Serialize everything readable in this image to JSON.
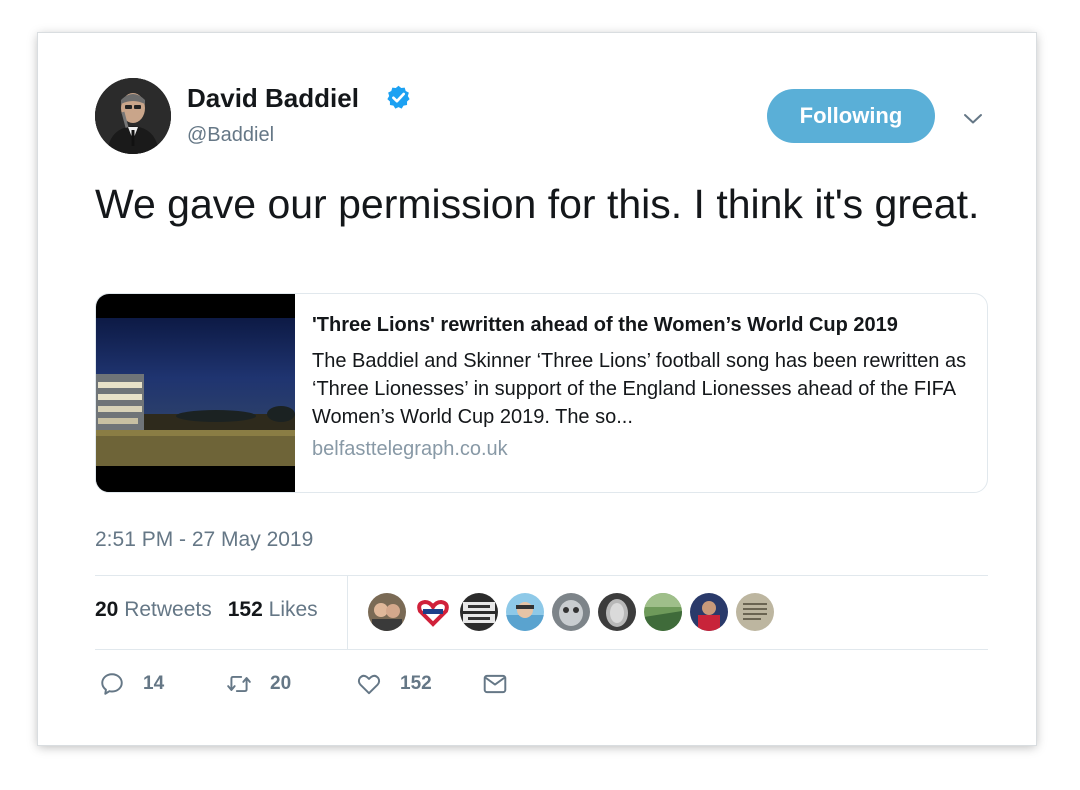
{
  "author": {
    "name": "David Baddiel",
    "handle": "@Baddiel",
    "verified": true
  },
  "follow_button": {
    "label": "Following",
    "color": "#5aafd7"
  },
  "tweet": {
    "text": "We gave our permission for this. I think it's great."
  },
  "link_card": {
    "title": "'Three Lions' rewritten ahead of the Women’s World Cup 2019",
    "description": "The Baddiel and Skinner ‘Three Lions’ football song has been rewritten as ‘Three Lionesses’ in support of the England Lionesses ahead of the FIFA Women’s World Cup 2019. The so...",
    "domain": "belfasttelegraph.co.uk"
  },
  "timestamp": "2:51 PM - 27 May 2019",
  "stats": {
    "retweets_count": "20",
    "retweets_label": "Retweets",
    "likes_count": "152",
    "likes_label": "Likes"
  },
  "liker_avatars": [
    {
      "name": "liker-1",
      "color": "#6b5a4a"
    },
    {
      "name": "liker-2",
      "color": "#ffffff"
    },
    {
      "name": "liker-3",
      "color": "#2f3a2a",
      "text": "BEWARE TRAINS"
    },
    {
      "name": "liker-4",
      "color": "#8ec9e8"
    },
    {
      "name": "liker-5",
      "color": "#9aa3a8"
    },
    {
      "name": "liker-6",
      "color": "#555555"
    },
    {
      "name": "liker-7",
      "color": "#4f7a4a"
    },
    {
      "name": "liker-8",
      "color": "#3a4f8a"
    },
    {
      "name": "liker-9",
      "color": "#bdb6a0"
    }
  ],
  "actions": {
    "reply_count": "14",
    "retweet_count": "20",
    "like_count": "152"
  },
  "icons": {
    "verified": "verified-badge-icon",
    "caret": "chevron-down-icon",
    "reply": "reply-icon",
    "retweet": "retweet-icon",
    "like": "heart-icon",
    "dm": "envelope-icon"
  },
  "colors": {
    "accent": "#1da1f2",
    "muted": "#657786",
    "text": "#14171a"
  }
}
